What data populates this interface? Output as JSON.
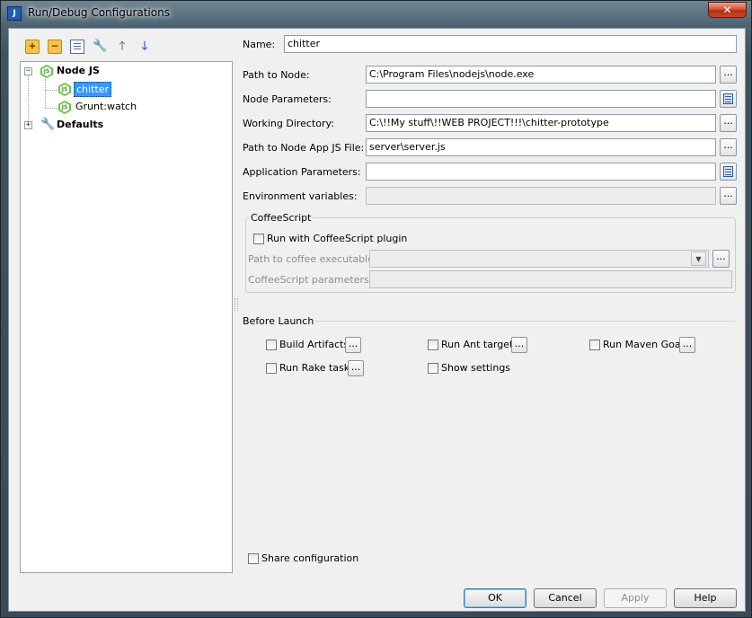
{
  "window": {
    "title": "Run/Debug Configurations",
    "app_icon": "J",
    "close_glyph": "✕"
  },
  "toolbar": {
    "add": "+",
    "remove": "−",
    "copy_icon": "copy-icon",
    "edit_defaults_icon": "wrench-icon",
    "up": "🡑",
    "down": "🡓"
  },
  "tree": {
    "root": {
      "label": "Node JS",
      "expander": "−"
    },
    "children": [
      {
        "label": "chitter",
        "selected": true,
        "icon": "JS"
      },
      {
        "label": "Grunt:watch",
        "selected": false,
        "icon": "JS"
      }
    ],
    "defaults": {
      "label": "Defaults",
      "expander": "+"
    }
  },
  "form": {
    "name_label": "Name:",
    "name_value": "chitter",
    "fields": [
      {
        "label": "Path to Node:",
        "value": "C:\\Program Files\\nodejs\\node.exe",
        "button": "..."
      },
      {
        "label": "Node Parameters:",
        "value": ""
      },
      {
        "label": "Working Directory:",
        "value": "C:\\!!My stuff\\!!WEB PROJECT!!!\\chitter-prototype",
        "button": "..."
      },
      {
        "label": "Path to Node App JS File:",
        "value": "server\\server.js",
        "button": "..."
      },
      {
        "label": "Application Parameters:",
        "value": ""
      },
      {
        "label": "Environment variables:",
        "value": "",
        "button": "..."
      }
    ]
  },
  "coffeescript": {
    "title": "CoffeeScript",
    "run_label": "Run with CoffeeScript plugin",
    "path_label": "Path to coffee executable:",
    "params_label": "CoffeeScript parameters:",
    "combo_arrow": "▼",
    "button": "..."
  },
  "before_launch": {
    "title": "Before Launch",
    "items": [
      {
        "label": "Build Artifacts",
        "button": "..."
      },
      {
        "label": "Run Ant target",
        "button": "..."
      },
      {
        "label": "Run Maven Goal",
        "button": "..."
      },
      {
        "label": "Run Rake task",
        "button": "..."
      },
      {
        "label": "Show settings"
      }
    ]
  },
  "share_label": "Share configuration",
  "buttons": {
    "ok": "OK",
    "cancel": "Cancel",
    "apply": "Apply",
    "help": "Help"
  }
}
